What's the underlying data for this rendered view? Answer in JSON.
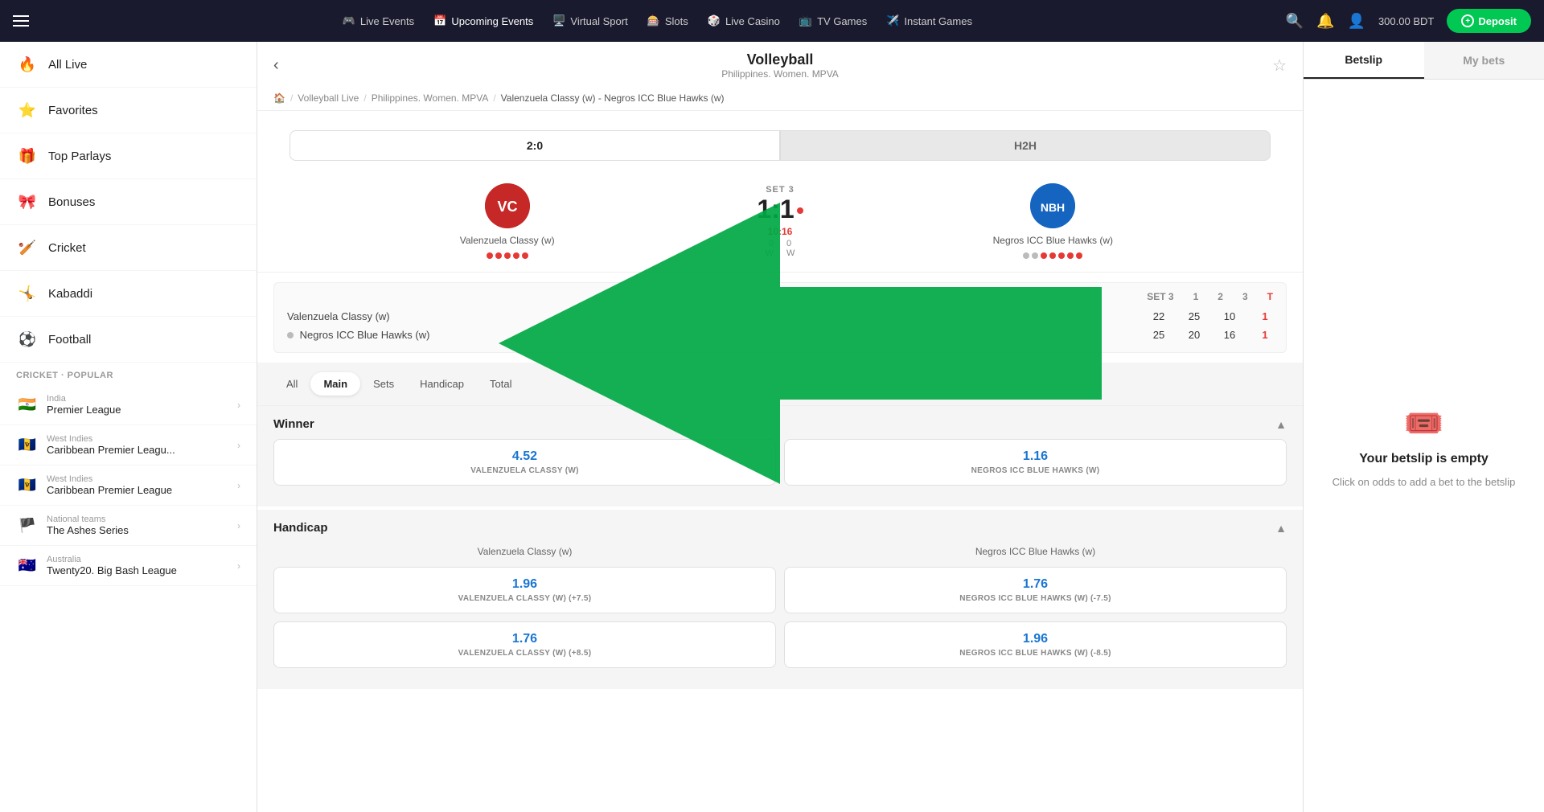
{
  "topnav": {
    "hamburger": "☰",
    "items": [
      {
        "id": "live-events",
        "icon": "🎮",
        "label": "Live Events"
      },
      {
        "id": "upcoming-events",
        "icon": "📅",
        "label": "Upcoming Events"
      },
      {
        "id": "virtual-sport",
        "icon": "🖥️",
        "label": "Virtual Sport"
      },
      {
        "id": "slots",
        "icon": "🎰",
        "label": "Slots"
      },
      {
        "id": "live-casino",
        "icon": "🎲",
        "label": "Live Casino"
      },
      {
        "id": "tv-games",
        "icon": "📺",
        "label": "TV Games"
      },
      {
        "id": "instant-games",
        "icon": "✈️",
        "label": "Instant Games"
      }
    ],
    "balance": "300.00 BDT",
    "deposit_label": "Deposit"
  },
  "sidebar": {
    "menu_items": [
      {
        "id": "all-live",
        "icon": "🔥",
        "label": "All Live"
      },
      {
        "id": "favorites",
        "icon": "⭐",
        "label": "Favorites"
      },
      {
        "id": "top-parlays",
        "icon": "🎁",
        "label": "Top Parlays"
      },
      {
        "id": "bonuses",
        "icon": "🎀",
        "label": "Bonuses"
      },
      {
        "id": "cricket",
        "icon": "🏏",
        "label": "Cricket"
      },
      {
        "id": "kabaddi",
        "icon": "🤸",
        "label": "Kabaddi"
      },
      {
        "id": "football",
        "icon": "⚽",
        "label": "Football"
      }
    ],
    "section_label": "CRICKET · POPULAR",
    "leagues": [
      {
        "flag": "🇮🇳",
        "country": "India",
        "name": "Premier League"
      },
      {
        "flag": "🇧🇧",
        "country": "West Indies",
        "name": "Caribbean Premier Leagu..."
      },
      {
        "flag": "🇧🇧",
        "country": "West Indies",
        "name": "Caribbean Premier League"
      },
      {
        "flag": "🏴",
        "country": "National teams",
        "name": "The Ashes Series"
      },
      {
        "flag": "🇦🇺",
        "country": "Australia",
        "name": "Twenty20. Big Bash League"
      }
    ]
  },
  "page": {
    "back_label": "‹",
    "title": "Volleyball",
    "subtitle": "Philippines. Women. MPVA",
    "star": "☆",
    "breadcrumb": [
      {
        "label": "🏠",
        "id": "home"
      },
      {
        "label": "Volleyball Live",
        "id": "volleyball-live"
      },
      {
        "label": "Philippines. Women. MPVA",
        "id": "league"
      },
      {
        "label": "Valenzuela Classy (w) - Negros ICC Blue Hawks (w)",
        "id": "match",
        "current": true
      }
    ]
  },
  "score_tabs": [
    {
      "label": "2:0",
      "active": true
    },
    {
      "label": "H2H",
      "active": false
    }
  ],
  "match": {
    "set_label": "SET 3",
    "score": "1:1",
    "time": "10:16",
    "w_labels": [
      "W",
      "W"
    ],
    "team1": {
      "name": "Valenzuela Classy (w)",
      "dots": [
        "red",
        "red",
        "red",
        "red",
        "red"
      ],
      "logo_color": "#c62828"
    },
    "team2": {
      "name": "Negros ICC Blue Hawks (w)",
      "dots": [
        "gray",
        "gray",
        "red",
        "red",
        "red",
        "red",
        "red"
      ],
      "logo_color": "#1565c0"
    }
  },
  "set_table": {
    "headers": [
      "1",
      "2",
      "3",
      "T"
    ],
    "rows": [
      {
        "team": "Valenzuela Classy (w)",
        "scores": [
          "22",
          "25",
          "10",
          "1"
        ],
        "highlight": [
          3
        ]
      },
      {
        "team": "Negros ICC Blue Hawks (w)",
        "dot": true,
        "scores": [
          "25",
          "20",
          "16",
          "1"
        ],
        "highlight": [
          3
        ]
      }
    ]
  },
  "bet_tabs": [
    {
      "label": "All",
      "active": false
    },
    {
      "label": "Main",
      "active": true
    },
    {
      "label": "Sets",
      "active": false
    },
    {
      "label": "Handicap",
      "active": false
    },
    {
      "label": "Total",
      "active": false
    }
  ],
  "winner_section": {
    "title": "Winner",
    "odds": [
      {
        "value": "4.52",
        "label": "VALENZUELA CLASSY (W)"
      },
      {
        "value": "1.16",
        "label": "NEGROS ICC BLUE HAWKS (W)"
      }
    ]
  },
  "handicap_section": {
    "title": "Handicap",
    "teams": [
      "Valenzuela Classy (w)",
      "Negros ICC Blue Hawks (w)"
    ],
    "rows": [
      [
        {
          "value": "1.96",
          "label": "VALENZUELA CLASSY (W) (+7.5)"
        },
        {
          "value": "1.76",
          "label": "NEGROS ICC BLUE HAWKS (W) (-7.5)"
        }
      ],
      [
        {
          "value": "1.76",
          "label": "VALENZUELA CLASSY (W) (+8.5)"
        },
        {
          "value": "1.96",
          "label": "NEGROS ICC BLUE HAWKS (W) (-8.5)"
        }
      ]
    ]
  },
  "betslip": {
    "tabs": [
      {
        "label": "Betslip",
        "active": true
      },
      {
        "label": "My bets",
        "active": false
      }
    ],
    "empty_title": "Your betslip is empty",
    "empty_subtitle": "Click on odds to add a bet to the betslip"
  }
}
